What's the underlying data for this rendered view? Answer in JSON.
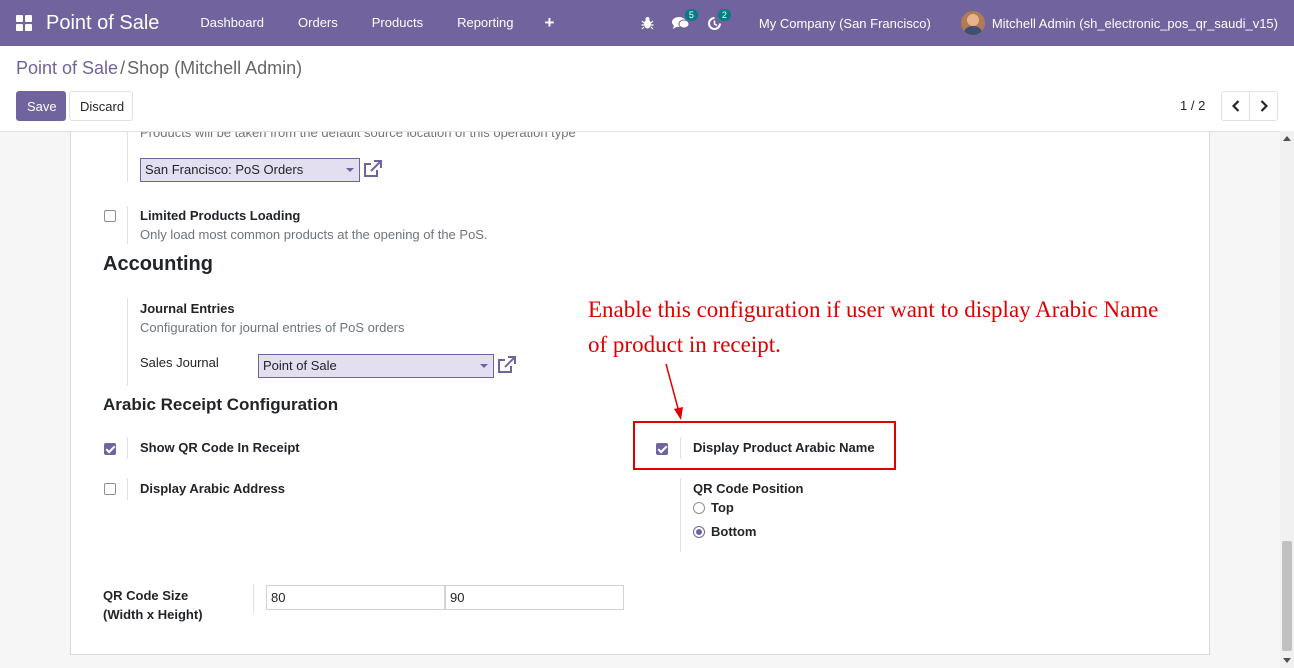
{
  "navbar": {
    "brand": "Point of Sale",
    "menu": [
      "Dashboard",
      "Orders",
      "Products",
      "Reporting"
    ],
    "plus": "+",
    "chat_badge": "5",
    "activity_badge": "2",
    "company": "My Company (San Francisco)",
    "user": "Mitchell Admin (sh_electronic_pos_qr_saudi_v15)"
  },
  "breadcrumb": {
    "parent": "Point of Sale",
    "separator": "/",
    "current": "Shop (Mitchell Admin)"
  },
  "actions": {
    "save": "Save",
    "discard": "Discard"
  },
  "pager": {
    "text": "1 / 2"
  },
  "form": {
    "operation_type_help": "Products will be taken from the default source location of this operation type",
    "operation_type_value": "San Francisco: PoS Orders",
    "limited_loading_label": "Limited Products Loading",
    "limited_loading_help": "Only load most common products at the opening of the PoS.",
    "limited_loading_checked": false,
    "accounting_title": "Accounting",
    "journal_entries_label": "Journal Entries",
    "journal_entries_help": "Configuration for journal entries of PoS orders",
    "sales_journal_label": "Sales Journal",
    "sales_journal_value": "Point of Sale",
    "arabic_title": "Arabic Receipt Configuration",
    "show_qr_label": "Show QR Code In Receipt",
    "show_qr_checked": true,
    "display_arabic_name_label": "Display Product Arabic Name",
    "display_arabic_name_checked": true,
    "display_arabic_address_label": "Display Arabic Address",
    "display_arabic_address_checked": false,
    "qr_position_label": "QR Code Position",
    "qr_position_options": [
      "Top",
      "Bottom"
    ],
    "qr_position_selected": "Bottom",
    "qr_size_label_line1": "QR Code Size",
    "qr_size_label_line2": "(Width x Height)",
    "qr_width": "80",
    "qr_height": "90"
  },
  "annotation": {
    "line1": "Enable this configuration if user want to display Arabic Name",
    "line2": "of product in receipt."
  },
  "colors": {
    "primary": "#71639e",
    "annotation": "#e00000",
    "badge": "#017e84"
  }
}
